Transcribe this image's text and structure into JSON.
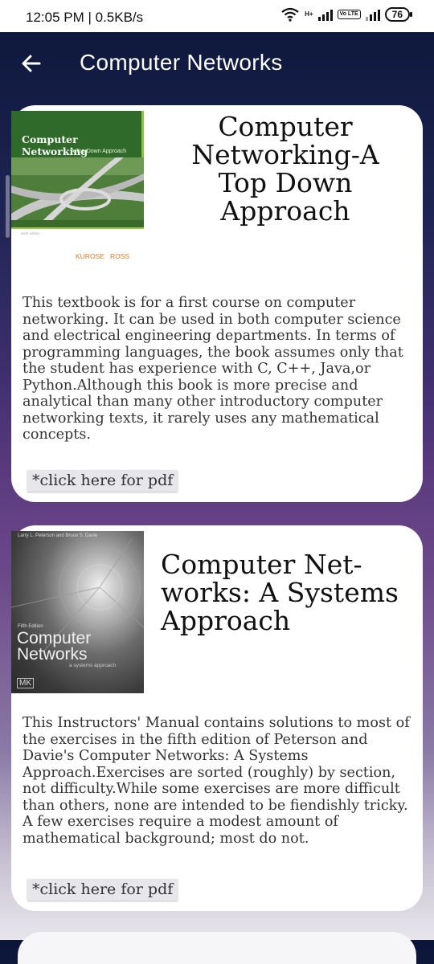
{
  "status_bar": {
    "time": "12:05 PM | 0.5KB/s",
    "network_tag": "H+",
    "volte": "Vo LTE",
    "battery": "76"
  },
  "app_bar": {
    "title": "Computer Networks",
    "back_icon": "arrow-left-icon"
  },
  "books": [
    {
      "cover": {
        "title": "Computer Networking",
        "subtitle": "A Top-Down Approach",
        "edition": "sixth edition",
        "authors": "KUROSE   ROSS"
      },
      "title": "Computer Networking-A Top Down Approach",
      "description": "This textbook is for a first course on computer networking. It can be used in both computer science and electrical engineering departments. In terms of programming languages, the book assumes only that the student has experience with C, C++, Java,or Python.Although this book is more precise and analytical than many other introductory computer networking texts, it rarely uses any mathematical concepts.",
      "button": "*click here for pdf"
    },
    {
      "cover": {
        "authors": "Larry L. Peterson and Bruce S. Davie",
        "edition": "Fifth Edition",
        "title_line1": "Computer",
        "title_line2": "Networks",
        "subtitle": "a systems approach",
        "publisher": "MK"
      },
      "title": "Computer Net-works: A Systems Approach",
      "description": "This Instructors' Manual contains solutions to most of the exercises in the fifth edition of Peterson and Davie's Computer Networks: A Systems Approach.Exercises are sorted (roughly) by section, not difficulty.While some exercises are more difficult than others, none are intended to be fiendishly tricky. A few exercises require a modest amount of mathematical background; most do not.",
      "button": "*click here for pdf"
    }
  ]
}
